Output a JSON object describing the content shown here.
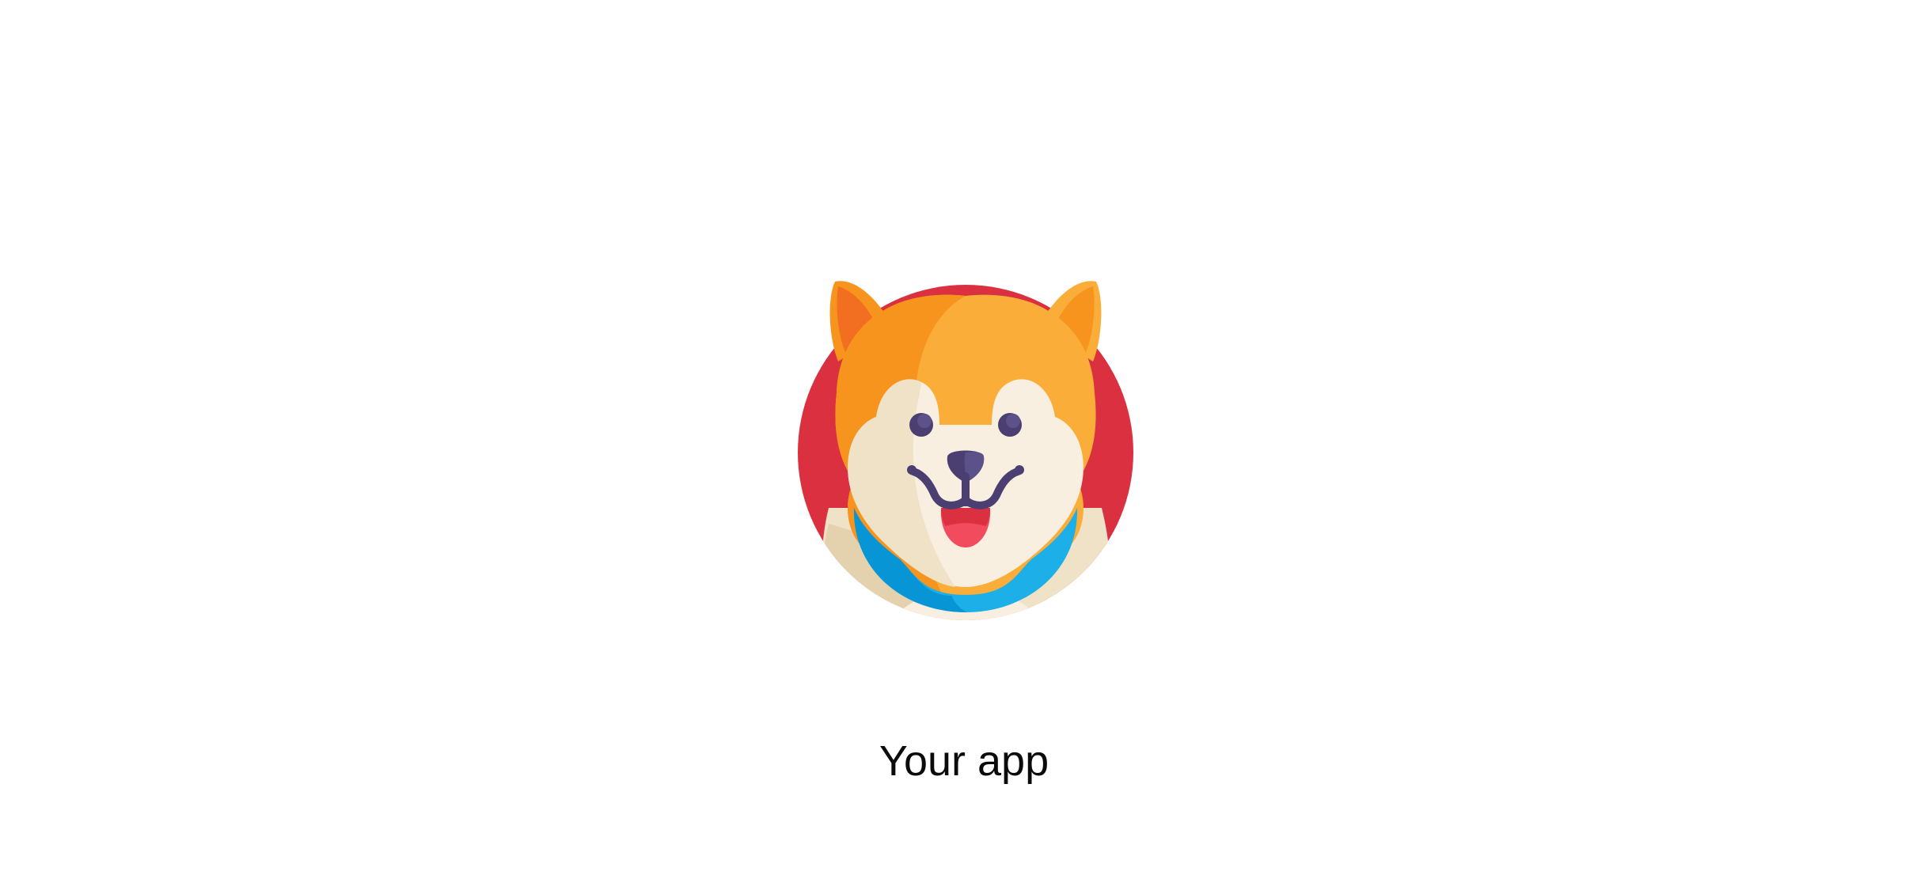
{
  "app": {
    "name": "Your app"
  },
  "logo": {
    "icon": "dog-face-icon",
    "colors": {
      "circle": "#db3040",
      "fur_orange": "#f7941d",
      "fur_light_orange": "#fbad3a",
      "ear_inner": "#f26f21",
      "face_cream": "#f9efe0",
      "face_shadow": "#efe2c6",
      "body_shadow": "#e4d2ae",
      "collar_dark": "#0795d6",
      "collar_light": "#1cafe8",
      "features": "#4a3f70",
      "tongue": "#f24b5e"
    }
  }
}
